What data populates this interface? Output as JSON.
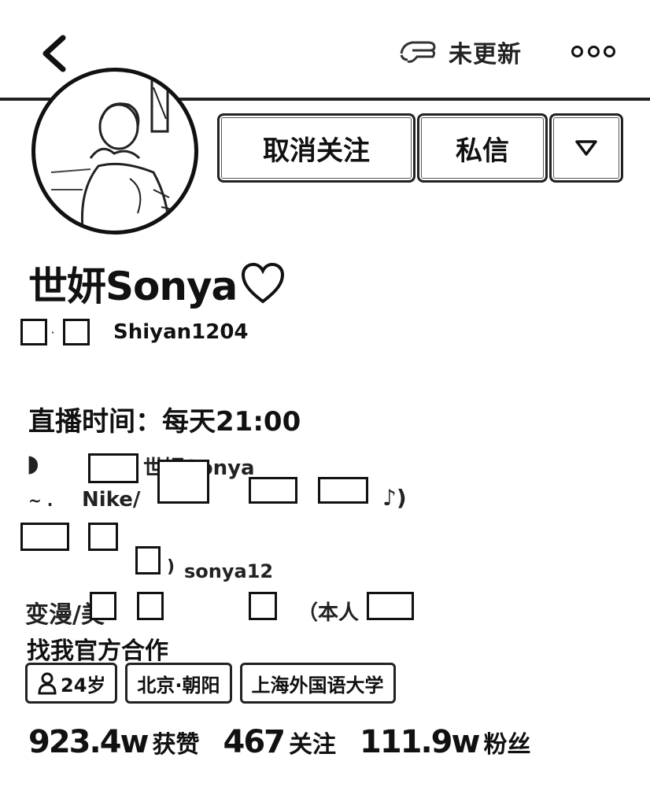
{
  "header": {
    "update_text": "未更新",
    "back_icon": "chevron-left-icon",
    "update_icon": "share-hand-icon",
    "more_icon": "more-dots-icon"
  },
  "actions": {
    "unfollow_label": "取消关注",
    "message_label": "私信",
    "dropdown_icon": "triangle-down-icon"
  },
  "profile": {
    "name": "世妍Sonya",
    "name_icon": "heart-icon",
    "id": "Shiyan1204",
    "live_time": "直播时间：每天21:00",
    "partner_line": "找我官方合作"
  },
  "bio_fragments": {
    "f1": "世妍Sonya",
    "f2": "Nike/",
    "f3": "sonya12",
    "f4": "变漫/美",
    "f5": "（本人"
  },
  "tags": [
    {
      "label": "24岁",
      "icon": "person-icon"
    },
    {
      "label": "北京·朝阳"
    },
    {
      "label": "上海外国语大学"
    }
  ],
  "stats": [
    {
      "value": "923.4w",
      "label": "获赞"
    },
    {
      "value": "467",
      "label": "关注"
    },
    {
      "value": "111.9w",
      "label": "粉丝"
    }
  ]
}
